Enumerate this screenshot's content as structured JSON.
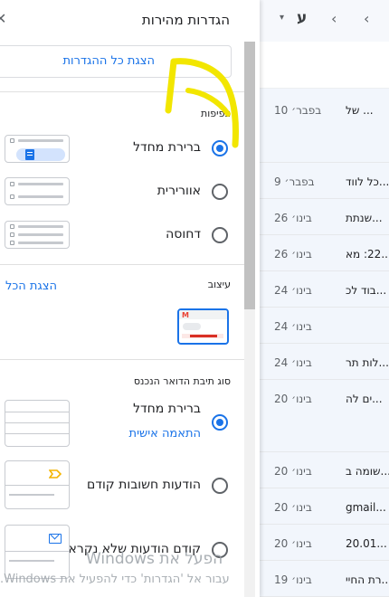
{
  "mail_toolbar": {
    "language_glyph": "ע",
    "caret_glyph": "▾",
    "prev_glyph": "‹",
    "next_glyph": "‹"
  },
  "mail_list": [
    {
      "date": "10 בפבר׳",
      "snippet": "... של"
    },
    {
      "date": "9 בפבר׳",
      "snippet": "...כל לווד"
    },
    {
      "date": "26 בינו׳",
      "snippet": "...שנתת"
    },
    {
      "date": "26 בינו׳",
      "snippet": "...22: מא"
    },
    {
      "date": "24 בינו׳",
      "snippet": "...בוד לכ"
    },
    {
      "date": "24 בינו׳",
      "snippet": ""
    },
    {
      "date": "24 בינו׳",
      "snippet": "...לות תר"
    },
    {
      "date": "20 בינו׳",
      "snippet": "...ים לה"
    },
    {
      "date": "20 בינו׳",
      "snippet": "...שומה ב"
    },
    {
      "date": "20 בינו׳",
      "snippet": "...gmail"
    },
    {
      "date": "20 בינו׳",
      "snippet": "...20.01"
    },
    {
      "date": "19 בינו׳",
      "snippet": "...רת החיי"
    }
  ],
  "panel": {
    "title": "הגדרות מהירות",
    "close_glyph": "✕",
    "show_all_settings": "הצגת כל ההגדרות",
    "density": {
      "label": "צפיפות",
      "options": [
        {
          "label": "ברירת מחדל",
          "selected": true
        },
        {
          "label": "אוורירית",
          "selected": false
        },
        {
          "label": "דחוסה",
          "selected": false
        }
      ]
    },
    "theme": {
      "label": "עיצוב",
      "link": "הצגת הכל",
      "thumb_logo": "M"
    },
    "inbox_type": {
      "label": "סוג תיבת הדואר הנכנס",
      "options": [
        {
          "label": "ברירת מחדל",
          "sub": "התאמה אישית",
          "selected": true
        },
        {
          "label": "הודעות חשובות קודם",
          "selected": false
        },
        {
          "label": "קודם הודעות שלא נקראו",
          "selected": false
        }
      ]
    }
  },
  "watermark": {
    "title": "הפעל את Windows",
    "subtitle": "עבור אל 'הגדרות' כדי להפעיל את Windows."
  },
  "colors": {
    "accent": "#1a73e8",
    "annotation": "#f2e600"
  }
}
